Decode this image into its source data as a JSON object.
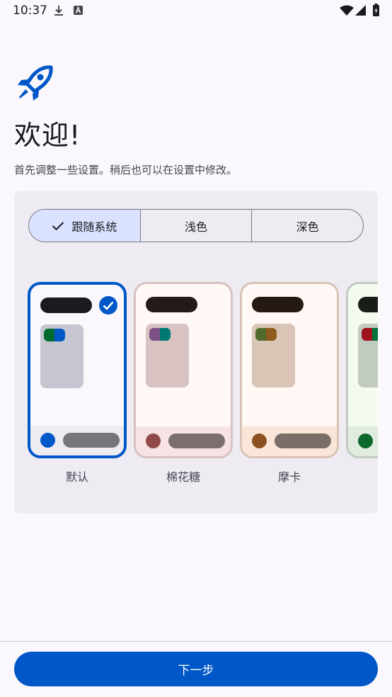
{
  "status_bar": {
    "time": "10:37",
    "icons": [
      "download-icon",
      "font-notification-icon",
      "wifi-icon",
      "signal-icon",
      "battery-icon"
    ]
  },
  "header": {
    "icon": "rocket-icon",
    "title": "欢迎!",
    "subtitle": "首先调整一些设置。稍后也可以在设置中修改。"
  },
  "mode_selector": {
    "options": [
      {
        "label": "跟随系统",
        "selected": true
      },
      {
        "label": "浅色",
        "selected": false
      },
      {
        "label": "深色",
        "selected": false
      }
    ]
  },
  "themes": [
    {
      "name": "默认",
      "selected": true,
      "frame": "#0057c7",
      "bg": "#fbf8fd",
      "bottom": "#eeebf3",
      "topbar": "#1b1b1f",
      "widget": "#c5c6d0",
      "dot1": "#006b2e",
      "dot2": "#0057c7",
      "circle": "#0057c7",
      "pill": "#75757a"
    },
    {
      "name": "棉花糖",
      "selected": false,
      "frame": "#d7c1c1",
      "bg": "#fff8f7",
      "bottom": "#f7e3e3",
      "topbar": "#231a1a",
      "widget": "#d8c2c2",
      "dot1": "#7d4f86",
      "dot2": "#007a72",
      "circle": "#904a4a",
      "pill": "#7a6e6e"
    },
    {
      "name": "摩卡",
      "selected": false,
      "frame": "#d8c3b5",
      "bg": "#fff8f4",
      "bottom": "#f9e6d9",
      "topbar": "#251a13",
      "widget": "#d9c4b6",
      "dot1": "#506b2c",
      "dot2": "#8f5a1f",
      "circle": "#8b5220",
      "pill": "#7a6f68"
    },
    {
      "name": "",
      "selected": false,
      "frame": "#c2cbc0",
      "bg": "#f3faef",
      "bottom": "#e2ebdf",
      "topbar": "#181d18",
      "widget": "#c2cbc0",
      "dot1": "#a0121c",
      "dot2": "#00743a",
      "circle": "#0e6a2c",
      "pill": "#70776e"
    }
  ],
  "footer": {
    "next_label": "下一步"
  }
}
